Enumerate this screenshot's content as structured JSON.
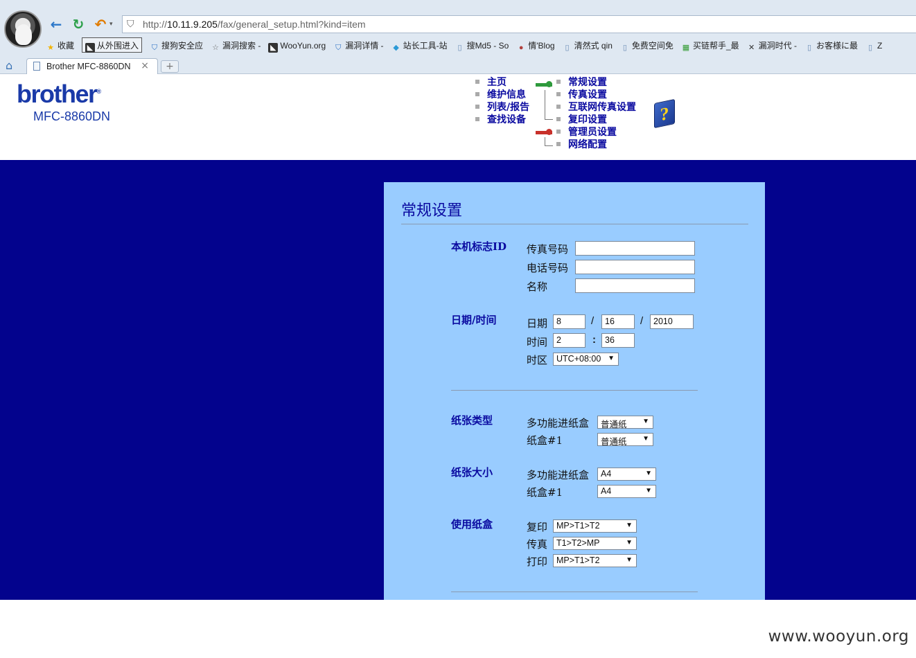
{
  "browser": {
    "url_prefix": "http://",
    "url_host": "10.11.9.205",
    "url_path": "/fax/general_setup.html?kind=item",
    "bookmarks": [
      {
        "label": "收藏",
        "icon": "star-icon"
      },
      {
        "label": "从外围进入",
        "icon": "wooyun-icon"
      },
      {
        "label": "搜狗安全应",
        "icon": "shield-icon"
      },
      {
        "label": "漏洞搜索 -",
        "icon": "star-outline-icon"
      },
      {
        "label": "WooYun.org",
        "icon": "wooyun-icon"
      },
      {
        "label": "漏洞详情 -",
        "icon": "shield-icon"
      },
      {
        "label": "站长工具-站",
        "icon": "chinaz-icon"
      },
      {
        "label": "搜Md5 - So",
        "icon": "page-icon"
      },
      {
        "label": "情'Blog",
        "icon": "avatar-icon"
      },
      {
        "label": "清然式 qin",
        "icon": "page-icon"
      },
      {
        "label": "免费空间免",
        "icon": "page-icon"
      },
      {
        "label": "买链帮手_最",
        "icon": "grid-icon"
      },
      {
        "label": "漏洞时代 -",
        "icon": "x-icon"
      },
      {
        "label": "お客様に最",
        "icon": "page-icon"
      },
      {
        "label": "Z",
        "icon": "page-icon"
      }
    ],
    "tab_title": "Brother MFC-8860DN",
    "tab_close": "×",
    "new_tab": "+"
  },
  "header": {
    "logo": "brother",
    "logo_mark": "®",
    "model": "MFC-8860DN",
    "menu_left": [
      "主页",
      "维护信息",
      "列表/报告",
      "查找设备"
    ],
    "menu_right": [
      "常规设置",
      "传真设置",
      "互联网传真设置",
      "复印设置",
      "管理员设置",
      "网络配置"
    ],
    "help": "?"
  },
  "page": {
    "title": "常规设置",
    "station_id": {
      "heading": "本机标志ID",
      "fax_label": "传真号码",
      "fax_value": "",
      "phone_label": "电话号码",
      "phone_value": "",
      "name_label": "名称",
      "name_value": ""
    },
    "datetime": {
      "heading": "日期/时间",
      "date_label": "日期",
      "month": "8",
      "day": "16",
      "year": "2010",
      "date_sep": "/",
      "time_label": "时间",
      "hour": "2",
      "minute": "36",
      "time_sep": ":",
      "tz_label": "时区",
      "tz_value": "UTC+08:00"
    },
    "paper_type": {
      "heading": "纸张类型",
      "mp_label": "多功能进纸盒",
      "mp_value": "普通纸",
      "tray1_label": "纸盒#1",
      "tray1_value": "普通纸"
    },
    "paper_size": {
      "heading": "纸张大小",
      "mp_label": "多功能进纸盒",
      "mp_value": "A4",
      "tray1_label": "纸盒#1",
      "tray1_value": "A4"
    },
    "tray_use": {
      "heading": "使用纸盒",
      "copy_label": "复印",
      "copy_value": "MP>T1>T2",
      "fax_label": "传真",
      "fax_value": "T1>T2>MP",
      "print_label": "打印",
      "print_value": "MP>T1>T2"
    },
    "arrow": "▼"
  },
  "watermark": "www.wooyun.org"
}
